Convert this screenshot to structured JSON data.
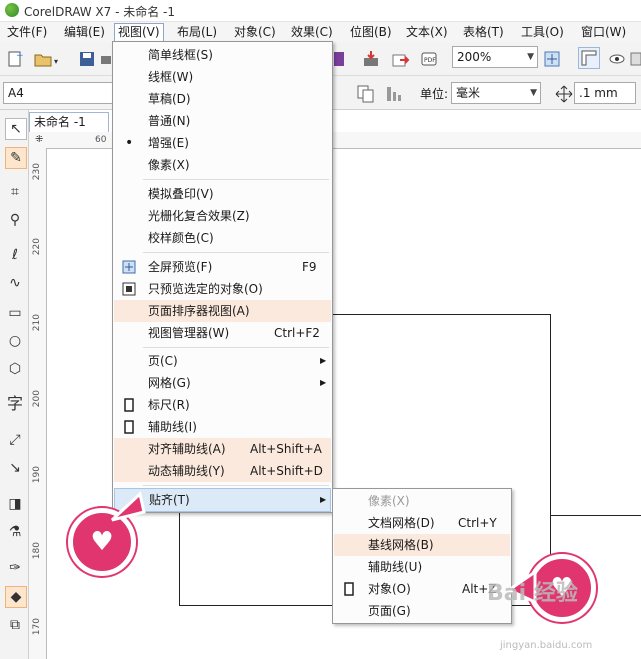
{
  "window": {
    "title": "CorelDRAW X7 - 未命名 -1"
  },
  "menubar": {
    "items": [
      "文件(F)",
      "编辑(E)",
      "视图(V)",
      "布局(L)",
      "对象(C)",
      "效果(C)",
      "位图(B)",
      "文本(X)",
      "表格(T)",
      "工具(O)",
      "窗口(W)"
    ]
  },
  "toolbar": {
    "zoom": "200%"
  },
  "property_bar": {
    "page_size": "A4",
    "unit_label": "单位:",
    "unit_value": "毫米",
    "nudge": ".1 mm"
  },
  "document": {
    "tab": "未命名 -1"
  },
  "rulers": {
    "h_ticks": [
      "60"
    ],
    "v_ticks": [
      "230",
      "220",
      "210",
      "200",
      "190",
      "180",
      "170"
    ]
  },
  "view_menu": {
    "items": [
      {
        "label": "简单线框(S)"
      },
      {
        "label": "线框(W)"
      },
      {
        "label": "草稿(D)"
      },
      {
        "label": "普通(N)"
      },
      {
        "label": "增强(E)",
        "checked": "•"
      },
      {
        "label": "像素(X)"
      },
      {
        "label": "模拟叠印(V)"
      },
      {
        "label": "光栅化复合效果(Z)"
      },
      {
        "label": "校样颜色(C)"
      },
      {
        "label": "全屏预览(F)",
        "shortcut": "F9",
        "icon": "fullscreen-preview-icon"
      },
      {
        "label": "只预览选定的对象(O)",
        "icon": "preview-selected-icon"
      },
      {
        "label": "页面排序器视图(A)"
      },
      {
        "label": "视图管理器(W)",
        "shortcut": "Ctrl+F2"
      },
      {
        "label": "页(C)",
        "submenu": true
      },
      {
        "label": "网格(G)",
        "submenu": true
      },
      {
        "label": "标尺(R)",
        "toggle": "checked-box-icon"
      },
      {
        "label": "辅助线(I)",
        "toggle": "checked-box-icon"
      },
      {
        "label": "对齐辅助线(A)",
        "shortcut": "Alt+Shift+A"
      },
      {
        "label": "动态辅助线(Y)",
        "shortcut": "Alt+Shift+D"
      },
      {
        "label": "贴齐(T)",
        "submenu": true
      }
    ]
  },
  "snap_submenu": {
    "items": [
      {
        "label": "像素(X)",
        "disabled": true
      },
      {
        "label": "文档网格(D)",
        "shortcut": "Ctrl+Y"
      },
      {
        "label": "基线网格(B)"
      },
      {
        "label": "辅助线(U)"
      },
      {
        "label": "对象(O)",
        "shortcut": "Alt+Z",
        "toggle": "checked-box-icon"
      },
      {
        "label": "页面(G)"
      }
    ]
  },
  "watermark": {
    "text": "Bai 经验",
    "url": "jingyan.baidu.com"
  },
  "colors": {
    "menu_highlight": "#fbe9dd",
    "selected_item": "#dceaf8",
    "badge": "#e0356e"
  }
}
